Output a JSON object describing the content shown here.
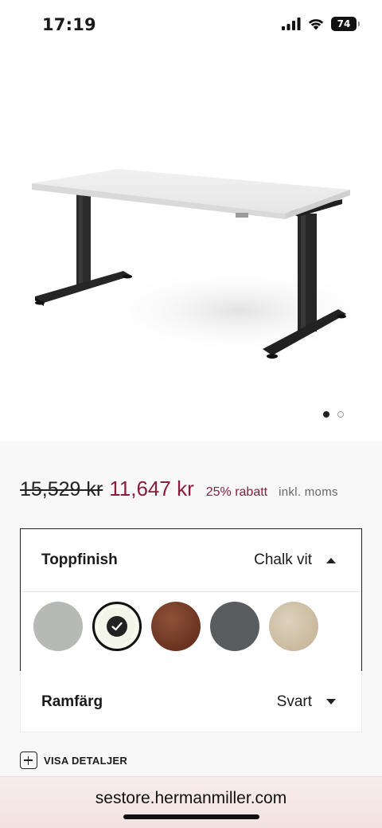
{
  "status_bar": {
    "time": "17:19",
    "battery": "74"
  },
  "hero": {
    "image": "height-adjustable-desk-white-top-black-frame",
    "pager": {
      "count": 2,
      "active_index": 0
    }
  },
  "price": {
    "old_price": "15,529 kr",
    "new_price": "11,647 kr",
    "discount": "25% rabatt",
    "vat_note": "inkl. moms"
  },
  "top_finish": {
    "label": "Toppfinish",
    "selected_value": "Chalk vit",
    "expanded": true,
    "swatches": [
      {
        "color": "#b7b9b4",
        "selected": false
      },
      {
        "color": "#f3f5e8",
        "selected": true
      },
      {
        "color": "#74391f",
        "selected": false
      },
      {
        "color": "#5a5d60",
        "selected": false
      },
      {
        "color": "#d6c9b1",
        "selected": false
      }
    ]
  },
  "frame_color": {
    "label": "Ramfärg",
    "selected_value": "Svart",
    "expanded": false
  },
  "details": {
    "label": "VISA DETALJER"
  },
  "browser": {
    "url": "sestore.hermanmiller.com"
  },
  "colors": {
    "accent": "#8a1c3c"
  }
}
